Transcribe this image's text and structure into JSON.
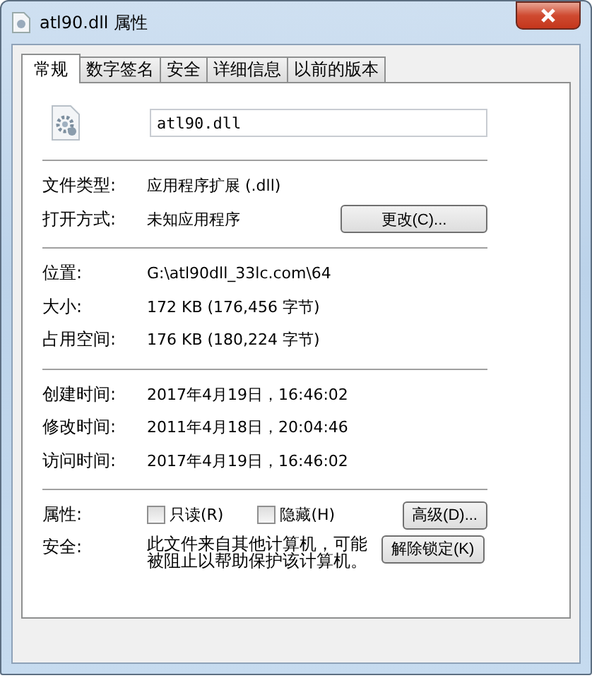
{
  "window": {
    "title": "atl90.dll 属性"
  },
  "tabs": [
    {
      "label": "常规",
      "selected": true
    },
    {
      "label": "数字签名",
      "selected": false
    },
    {
      "label": "安全",
      "selected": false
    },
    {
      "label": "详细信息",
      "selected": false
    },
    {
      "label": "以前的版本",
      "selected": false
    }
  ],
  "file": {
    "name": "atl90.dll"
  },
  "sections": [
    [
      {
        "label": "文件类型:",
        "value": "应用程序扩展 (.dll)"
      },
      {
        "label": "打开方式:",
        "value": "未知应用程序",
        "button": "更改(C)..."
      }
    ],
    [
      {
        "label": "位置:",
        "value": "G:\\atl90dll_33lc.com\\64"
      },
      {
        "label": "大小:",
        "value": "172 KB (176,456 字节)"
      },
      {
        "label": "占用空间:",
        "value": "176 KB (180,224 字节)"
      }
    ],
    [
      {
        "label": "创建时间:",
        "value": "2017年4月19日，16:46:02"
      },
      {
        "label": "修改时间:",
        "value": "2011年4月18日，20:04:46"
      },
      {
        "label": "访问时间:",
        "value": "2017年4月19日，16:46:02"
      }
    ]
  ],
  "attributes": {
    "label": "属性:",
    "checkboxes": [
      {
        "label": "只读(R)",
        "checked": false
      },
      {
        "label": "隐藏(H)",
        "checked": false
      }
    ],
    "button": "高级(D)..."
  },
  "security": {
    "label": "安全:",
    "text": "此文件来自其他计算机，可能被阻止以帮助保护该计算机。",
    "button": "解除锁定(K)"
  }
}
